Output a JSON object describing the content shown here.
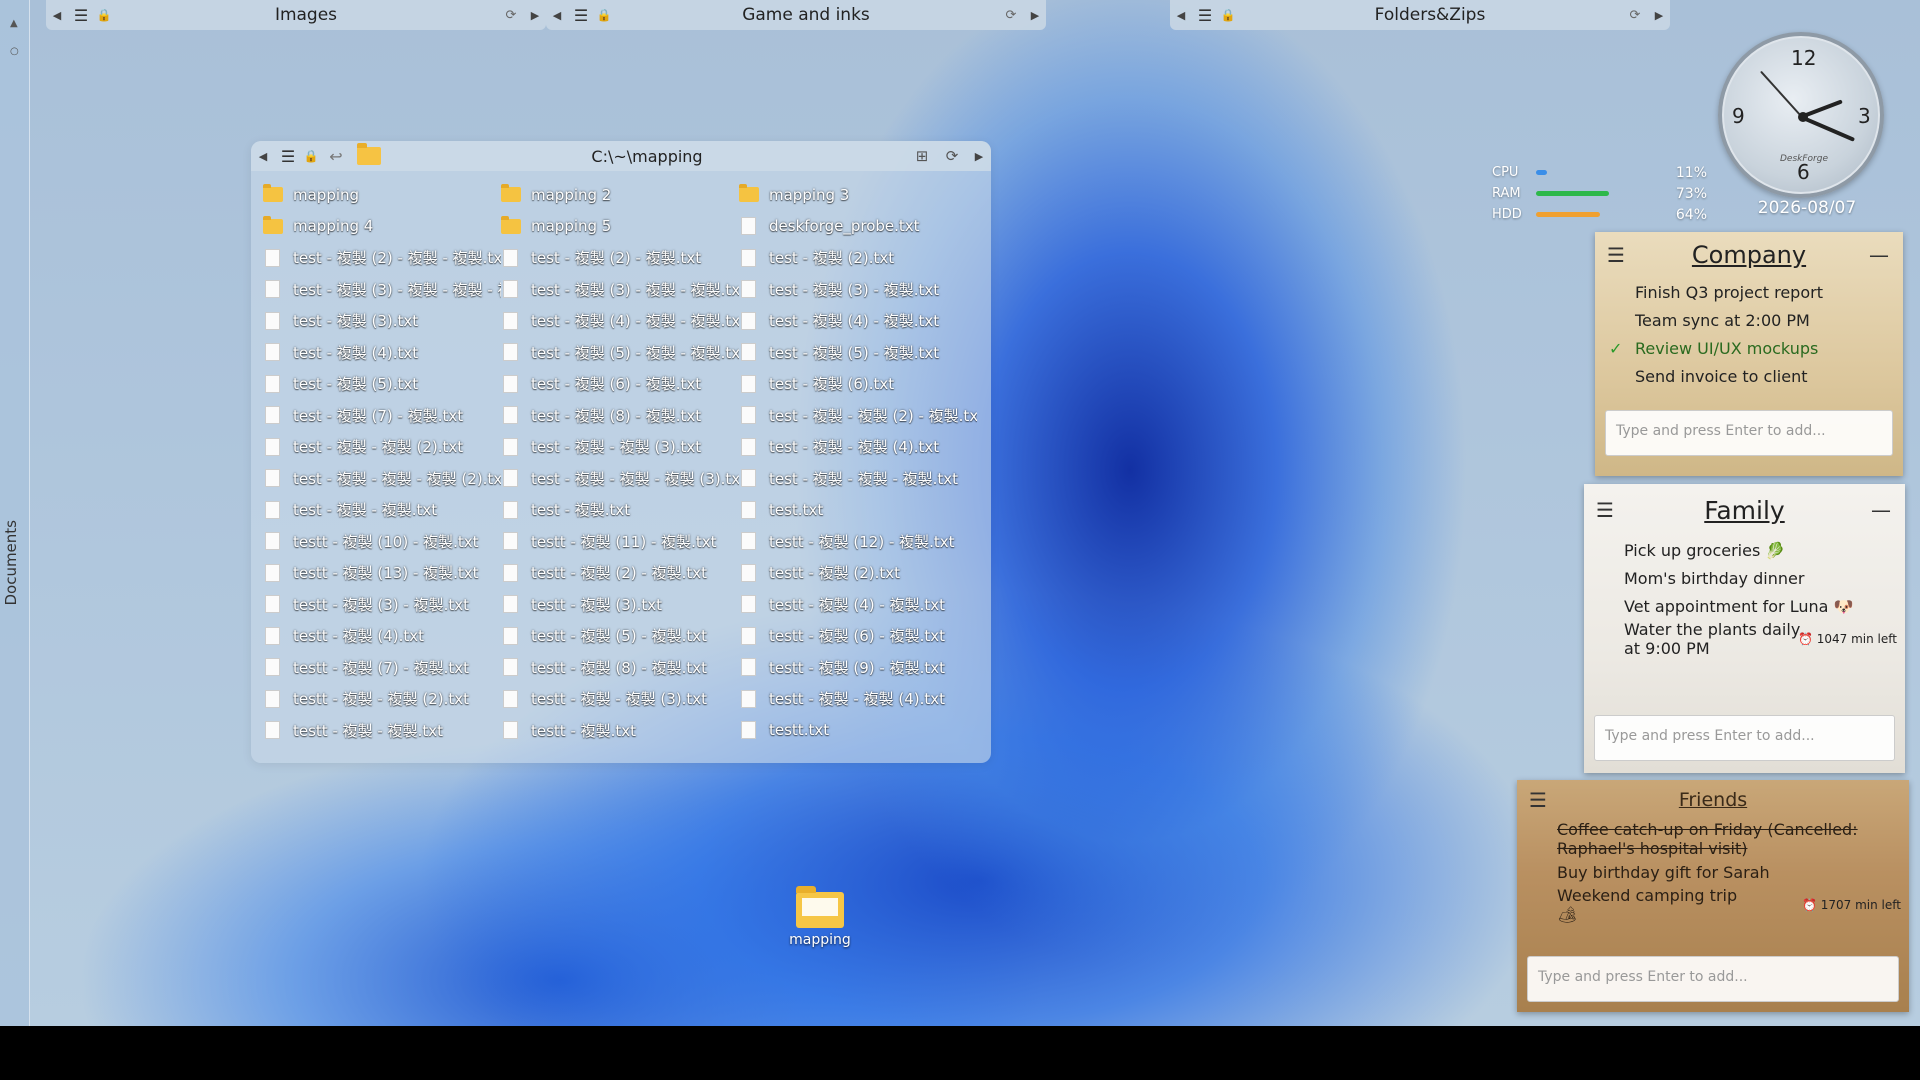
{
  "side_strip": {
    "label": "Documents"
  },
  "fences": [
    {
      "title": "Images"
    },
    {
      "title": "Game and inks"
    },
    {
      "title": "Folders&Zips"
    }
  ],
  "window": {
    "path": "C:\\~\\mapping",
    "files": [
      {
        "name": "mapping",
        "type": "folder"
      },
      {
        "name": "mapping 2",
        "type": "folder"
      },
      {
        "name": "mapping 3",
        "type": "folder"
      },
      {
        "name": "mapping 4",
        "type": "folder"
      },
      {
        "name": "mapping 5",
        "type": "folder"
      },
      {
        "name": "deskforge_probe.txt",
        "type": "file"
      },
      {
        "name": "test - 複製 (2) - 複製 - 複製.txt",
        "type": "file"
      },
      {
        "name": "test - 複製 (2) - 複製.txt",
        "type": "file"
      },
      {
        "name": "test - 複製 (2).txt",
        "type": "file"
      },
      {
        "name": "test - 複製 (3) - 複製 - 複製 - 複",
        "type": "file"
      },
      {
        "name": "test - 複製 (3) - 複製 - 複製.txt",
        "type": "file"
      },
      {
        "name": "test - 複製 (3) - 複製.txt",
        "type": "file"
      },
      {
        "name": "test - 複製 (3).txt",
        "type": "file"
      },
      {
        "name": "test - 複製 (4) - 複製 - 複製.txt",
        "type": "file"
      },
      {
        "name": "test - 複製 (4) - 複製.txt",
        "type": "file"
      },
      {
        "name": "test - 複製 (4).txt",
        "type": "file"
      },
      {
        "name": "test - 複製 (5) - 複製 - 複製.txt",
        "type": "file"
      },
      {
        "name": "test - 複製 (5) - 複製.txt",
        "type": "file"
      },
      {
        "name": "test - 複製 (5).txt",
        "type": "file"
      },
      {
        "name": "test - 複製 (6) - 複製.txt",
        "type": "file"
      },
      {
        "name": "test - 複製 (6).txt",
        "type": "file"
      },
      {
        "name": "test - 複製 (7) - 複製.txt",
        "type": "file"
      },
      {
        "name": "test - 複製 (8) - 複製.txt",
        "type": "file"
      },
      {
        "name": "test - 複製 - 複製 (2) - 複製.txt",
        "type": "file"
      },
      {
        "name": "test - 複製 - 複製 (2).txt",
        "type": "file"
      },
      {
        "name": "test - 複製 - 複製 (3).txt",
        "type": "file"
      },
      {
        "name": "test - 複製 - 複製 (4).txt",
        "type": "file"
      },
      {
        "name": "test - 複製 - 複製 - 複製 (2).txt",
        "type": "file"
      },
      {
        "name": "test - 複製 - 複製 - 複製 (3).txt",
        "type": "file"
      },
      {
        "name": "test - 複製 - 複製 - 複製.txt",
        "type": "file"
      },
      {
        "name": "test - 複製 - 複製.txt",
        "type": "file"
      },
      {
        "name": "test - 複製.txt",
        "type": "file"
      },
      {
        "name": "test.txt",
        "type": "file"
      },
      {
        "name": "testt - 複製 (10) - 複製.txt",
        "type": "file"
      },
      {
        "name": "testt - 複製 (11) - 複製.txt",
        "type": "file"
      },
      {
        "name": "testt - 複製 (12) - 複製.txt",
        "type": "file"
      },
      {
        "name": "testt - 複製 (13) - 複製.txt",
        "type": "file"
      },
      {
        "name": "testt - 複製 (2) - 複製.txt",
        "type": "file"
      },
      {
        "name": "testt - 複製 (2).txt",
        "type": "file"
      },
      {
        "name": "testt - 複製 (3) - 複製.txt",
        "type": "file"
      },
      {
        "name": "testt - 複製 (3).txt",
        "type": "file"
      },
      {
        "name": "testt - 複製 (4) - 複製.txt",
        "type": "file"
      },
      {
        "name": "testt - 複製 (4).txt",
        "type": "file"
      },
      {
        "name": "testt - 複製 (5) - 複製.txt",
        "type": "file"
      },
      {
        "name": "testt - 複製 (6) - 複製.txt",
        "type": "file"
      },
      {
        "name": "testt - 複製 (7) - 複製.txt",
        "type": "file"
      },
      {
        "name": "testt - 複製 (8) - 複製.txt",
        "type": "file"
      },
      {
        "name": "testt - 複製 (9) - 複製.txt",
        "type": "file"
      },
      {
        "name": "testt - 複製 - 複製 (2).txt",
        "type": "file"
      },
      {
        "name": "testt - 複製 - 複製 (3).txt",
        "type": "file"
      },
      {
        "name": "testt - 複製 - 複製 (4).txt",
        "type": "file"
      },
      {
        "name": "testt - 複製 - 複製.txt",
        "type": "file"
      },
      {
        "name": "testt - 複製.txt",
        "type": "file"
      },
      {
        "name": "testt.txt",
        "type": "file"
      }
    ]
  },
  "desktop_icons": [
    {
      "label": "mapping"
    }
  ],
  "clock": {
    "numerals": {
      "n12": "12",
      "n3": "3",
      "n6": "6",
      "n9": "9"
    },
    "brand": "DeskForge",
    "time": {
      "hour": 2,
      "minute": 18,
      "second": 53
    },
    "date": "2026-08/07"
  },
  "system": {
    "meters": [
      {
        "label": "CPU",
        "value": "11%",
        "fraction": 0.11,
        "color": "#3a8ee8"
      },
      {
        "label": "RAM",
        "value": "73%",
        "fraction": 0.73,
        "color": "#2db84a"
      },
      {
        "label": "HDD",
        "value": "64%",
        "fraction": 0.64,
        "color": "#f0a030"
      }
    ]
  },
  "todos": {
    "company": {
      "title": "Company",
      "items": [
        {
          "text": "Finish Q3 project report"
        },
        {
          "text": "Team sync at 2:00 PM"
        },
        {
          "text": "Review UI/UX mockups",
          "done": true
        },
        {
          "text": "Send invoice to client"
        }
      ],
      "placeholder": "Type and press Enter to add..."
    },
    "family": {
      "title": "Family",
      "items": [
        {
          "text": "Pick up groceries 🥬"
        },
        {
          "text": "Mom's birthday dinner"
        },
        {
          "text": "Vet appointment for Luna 🐶"
        },
        {
          "text": "Water the plants daily at 9:00 PM",
          "timer": "⏰ 1047 min left"
        }
      ],
      "placeholder": "Type and press Enter to add..."
    },
    "friends": {
      "title": "Friends",
      "items": [
        {
          "text": "Coffee catch-up on Friday (Cancelled: Raphael's hospital visit)",
          "struck": true
        },
        {
          "text": "Buy birthday gift for Sarah"
        },
        {
          "text": "Weekend camping trip 🏕",
          "timer": "⏰ 1707 min left"
        }
      ],
      "placeholder": "Type and press Enter to add..."
    }
  }
}
